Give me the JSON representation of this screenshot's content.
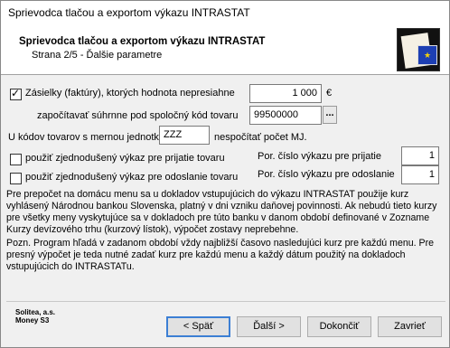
{
  "window": {
    "title": "Sprievodca tlačou a exportom výkazu INTRASTAT"
  },
  "header": {
    "title": "Sprievodca tlačou a exportom výkazu INTRASTAT",
    "subtitle": "Strana 2/5 - Ďalšie parametre"
  },
  "form": {
    "zasielky": {
      "checked": true,
      "label": "Zásielky (faktúry), ktorých hodnota nepresiahne",
      "value": "1 000",
      "unit": "€"
    },
    "kod": {
      "label": "započítavať súhrnne pod spoločný kód tovaru",
      "value": "99500000",
      "browse_label": "..."
    },
    "mj": {
      "label_before": "U kódov tovarov s mernou jednotkou",
      "value": "ZZZ",
      "label_after": "nespočítať počet MJ."
    },
    "prijatie": {
      "checked": false,
      "label": "použiť zjednodušený výkaz pre prijatie tovaru",
      "cislo_label": "Por. číslo výkazu pre prijatie",
      "cislo_value": "1"
    },
    "odoslanie": {
      "checked": false,
      "label": "použiť zjednodušený výkaz pre odoslanie tovaru",
      "cislo_label": "Por. číslo výkazu pre odoslanie",
      "cislo_value": "1"
    }
  },
  "info": {
    "p1": "Pre prepočet na domácu menu sa u dokladov vstupujúcich do výkazu INTRASTAT použije kurz vyhlásený Národnou bankou Slovenska, platný v dni vzniku daňovej povinnosti.  Ak nebudú tieto kurzy pre všetky meny vyskytujúce sa v dokladoch pre túto banku v danom období definované v Zozname Kurzy devízového trhu (kurzový lístok), výpočet zostavy neprebehne.",
    "p2": "Pozn. Program hľadá v zadanom období vždy najbližší časovo nasledujúci kurz pre každú menu. Pre presný výpočet je teda nutné zadať kurz pre každú menu a každý dátum použitý na dokladoch vstupujúcich do INTRASTATu."
  },
  "footer": {
    "company": "Solitea, a.s.",
    "product": "Money S3",
    "back_label": "< Späť",
    "next_label": "Ďalší >",
    "finish_label": "Dokončiť",
    "close_label": "Zavrieť"
  },
  "colors": {
    "focus_border": "#3c7fd4",
    "eu_blue": "#1d3fb3",
    "eu_star": "#f5d20b"
  }
}
